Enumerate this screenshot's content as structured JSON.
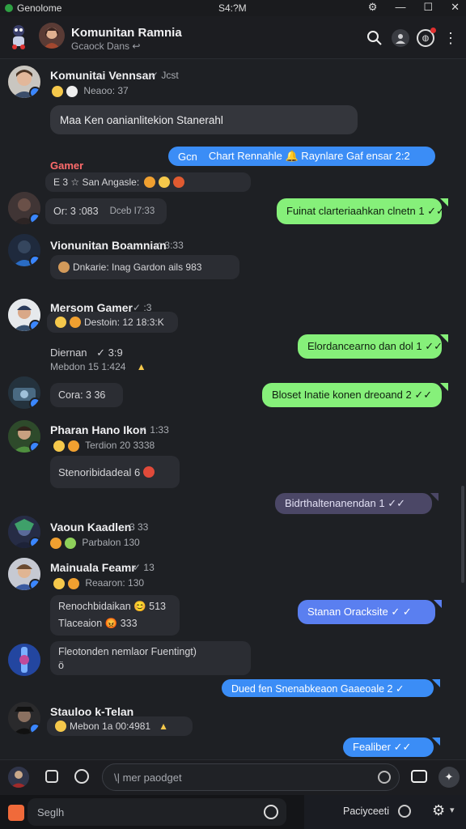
{
  "window": {
    "title": "Genolome",
    "clock": "S4:?M",
    "controls": [
      "⚙",
      "—",
      "☐",
      "✕"
    ]
  },
  "header": {
    "name": "Komunitan Ramnia",
    "subtitle": "Gcaock Dans ↩"
  },
  "messages": {
    "m1": {
      "name": "Komunitai Vennsan",
      "meta": "✓ Jcst",
      "reactions": "Neaoo: 37",
      "text": "Maa Ken oanianlitekion Stanerahl"
    },
    "out1": {
      "pre": "Gcn",
      "text": "Chart Rennahle 🔔 Raynlare Gaf ensar 2:2"
    },
    "gamer": {
      "name": "Gamer",
      "meta": "E 3 ☆ San Angasle:"
    },
    "m2": {
      "text": "Or: 3 :083",
      "meta": "Dceb I7:33"
    },
    "out2": {
      "text": "Fuinat clarteriaahkan clnetn 1 ✓✓"
    },
    "m3": {
      "name": "Vionunitan Boamnian",
      "meta": "✓ 3:33",
      "text": "Dnkarie: Inag Gardon ails 983"
    },
    "m4": {
      "name": "Mersom Gamer",
      "meta": "✓ :3",
      "reactions": "Destoin: 12 18:3:K"
    },
    "out3": {
      "text": "Elordancearno dan dol 1 ✓✓"
    },
    "m5": {
      "name": "Diernan",
      "meta": "✓ 3:9",
      "reactions": "Mebdon 15 1:424"
    },
    "m6": {
      "text": "Cora: 3 36"
    },
    "out4": {
      "text": "Bloset Inatie konen dreoand 2 ✓✓"
    },
    "m7": {
      "name": "Pharan Hano Ikon",
      "meta": "✓ 1:33",
      "reactions": "Terdion 20 3338",
      "text": "Stenoribidadeal 6"
    },
    "out5": {
      "text": "Bidrthaltenanendan 1 ✓✓"
    },
    "m8": {
      "name": "Vaoun Kaadlen",
      "meta": "3 33",
      "reactions": "Parbalon 130"
    },
    "m9": {
      "name": "Mainuala Feamr",
      "meta": "✓ 13",
      "reactions": "Reaaron: 130",
      "text1": "Renochbidaikan 😊 513",
      "text2": "Tlaceaion 😡 333"
    },
    "out6": {
      "text": "Stanan Oracksite ✓ ✓"
    },
    "m10": {
      "text": "Fleotonden nemlaor Fuentingt)",
      "sub": "ö"
    },
    "out7": {
      "text": "Dued fen Snenabkeaon Gaaeoale 2 ✓"
    },
    "m11": {
      "name": "Stauloo k-Telan",
      "meta": "Mebon 1a 00:4981"
    },
    "out8": {
      "text": "Fealiber ✓✓"
    }
  },
  "composer": {
    "placeholder": "\\| mer paodget"
  },
  "search": {
    "placeholder": "Seglh",
    "right_label": "Paciyceeti"
  },
  "colors": {
    "bg": "#1e2024",
    "green_bubble": "#86f07a",
    "blue_bubble": "#3b8df6",
    "purple_bubble": "#4b4766",
    "accent_badge": "#3a86ff"
  }
}
